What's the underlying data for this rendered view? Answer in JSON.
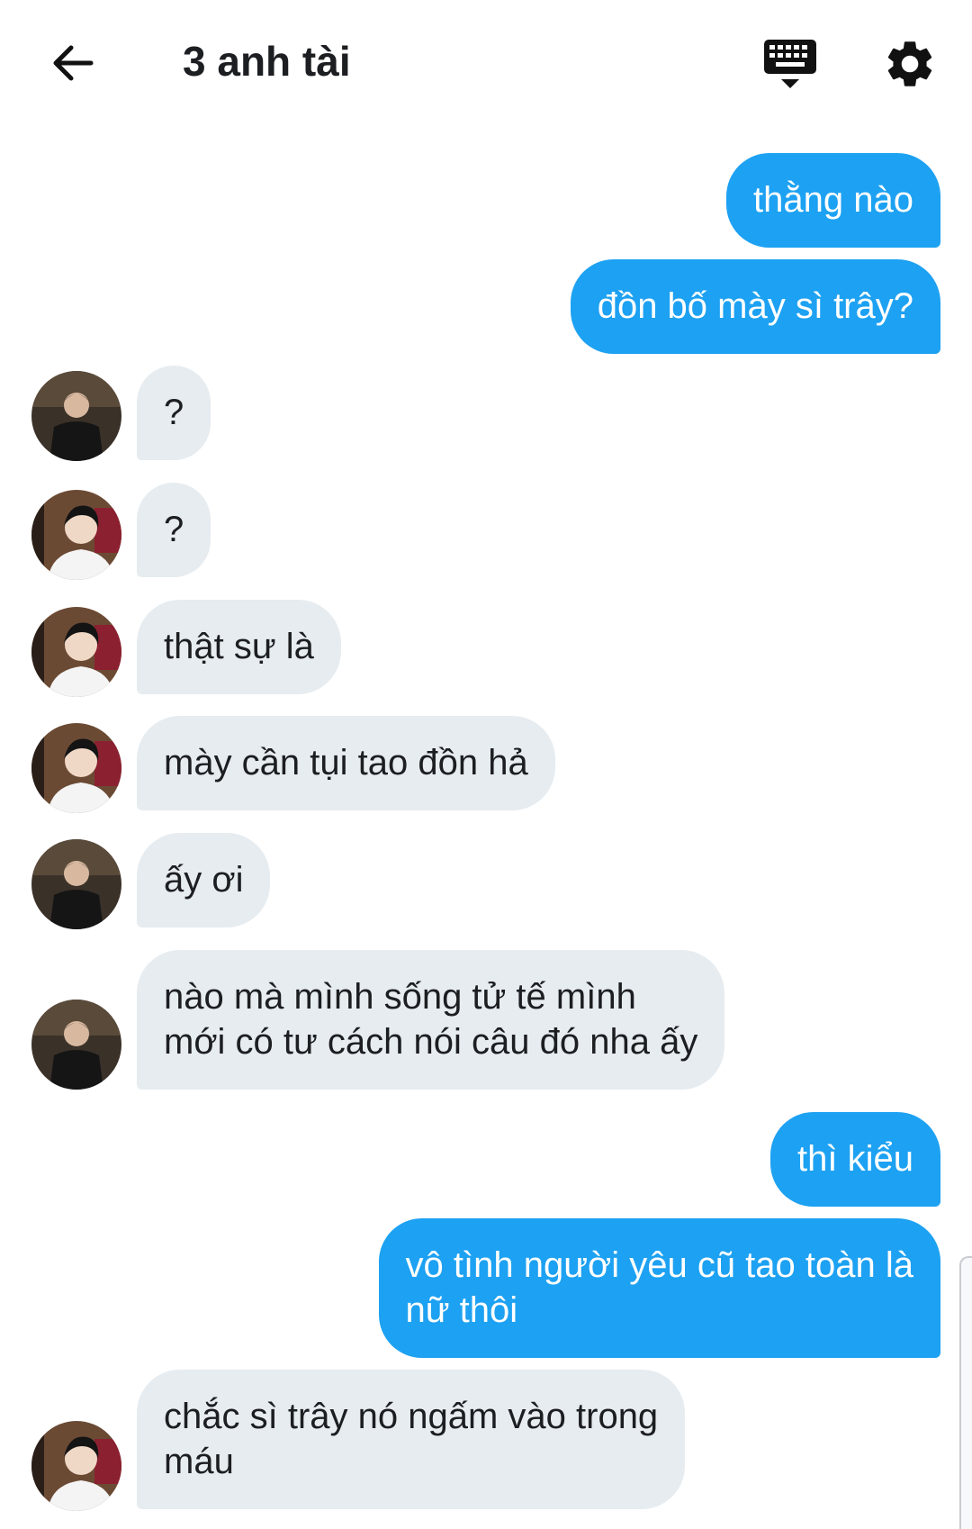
{
  "header": {
    "title": "3 anh tài"
  },
  "messages": [
    {
      "side": "sent",
      "text": "thằng nào"
    },
    {
      "side": "sent",
      "text": "đồn bố mày sì trây?"
    },
    {
      "side": "recv",
      "avatar": "dark-jacket-avatar",
      "text": "?"
    },
    {
      "side": "recv",
      "avatar": "white-shirt-avatar",
      "text": "?"
    },
    {
      "side": "recv",
      "avatar": "white-shirt-avatar",
      "text": "thật sự là"
    },
    {
      "side": "recv",
      "avatar": "white-shirt-avatar",
      "text": "mày cần tụi tao đồn hả"
    },
    {
      "side": "recv",
      "avatar": "dark-jacket-avatar",
      "text": "ấy ơi"
    },
    {
      "side": "recv",
      "avatar": "dark-jacket-avatar",
      "text": "nào mà mình sống tử tế mình\nmới có tư cách nói câu đó nha ấy"
    },
    {
      "side": "sent",
      "text": "thì kiểu"
    },
    {
      "side": "sent",
      "text": "vô tình người yêu cũ tao toàn là\nnữ thôi"
    },
    {
      "side": "recv",
      "avatar": "white-shirt-avatar",
      "text": "chắc sì trây nó ngấm vào trong\nmáu"
    }
  ],
  "colors": {
    "sent_bubble": "#1da1f2",
    "recv_bubble": "#e6ecf0",
    "text_dark": "#1c1e21"
  },
  "icons": [
    "back-arrow-icon",
    "keyboard-icon",
    "gear-icon"
  ]
}
